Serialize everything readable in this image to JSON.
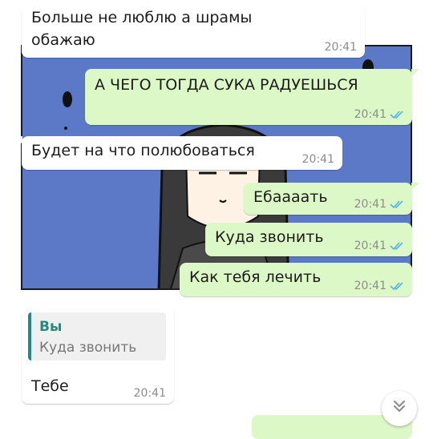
{
  "messages": [
    {
      "id": "m1",
      "type": "incoming",
      "text_lines": [
        "Больше не люблю а шрамы",
        "обажаю"
      ],
      "time": "20:41"
    },
    {
      "id": "m2",
      "type": "outgoing",
      "text": "А ЧЕГО ТОГДА СУКА РАДУЕШЬСЯ",
      "time": "20:41",
      "status": "read"
    },
    {
      "id": "m3",
      "type": "incoming",
      "text": "Будет на что полюбоваться",
      "time": "20:41"
    },
    {
      "id": "m4",
      "type": "outgoing",
      "text": "Ебаааать",
      "time": "20:41",
      "status": "read"
    },
    {
      "id": "m5",
      "type": "outgoing",
      "text": "Куда звонить",
      "time": "20:41",
      "status": "read"
    },
    {
      "id": "m6",
      "type": "outgoing",
      "text": "Как тебя лечить",
      "time": "20:41",
      "status": "read"
    },
    {
      "id": "m7",
      "type": "incoming",
      "reply_to": {
        "name": "Вы",
        "text": "Куда звонить"
      },
      "text": "Тебе",
      "time": "20:41"
    }
  ],
  "scroll_down_icon": "double-chevron-down-icon",
  "colors": {
    "incoming_bubble": "#ffffff",
    "outgoing_bubble": "#dcf8c6",
    "read_ticks": "#4fb6ec",
    "reply_accent": "#1e8c7e",
    "background_panel": "#5b79c7"
  }
}
